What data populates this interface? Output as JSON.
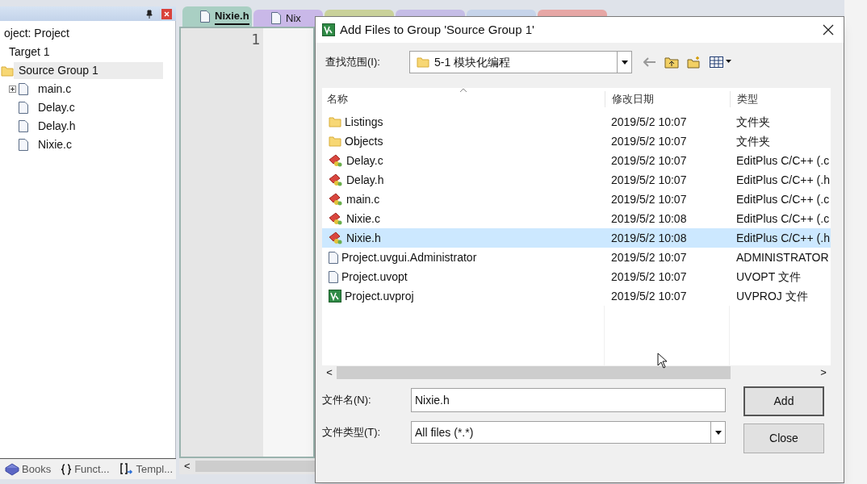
{
  "project_panel": {
    "tree": [
      {
        "label": "oject: Project",
        "selected": false,
        "children": [
          {
            "label": "Target 1",
            "selected": false,
            "children": [
              {
                "label": "Source Group 1",
                "selected": true,
                "kind": "folder",
                "children": [
                  {
                    "label": "main.c",
                    "kind": "file",
                    "expandable": true,
                    "selected": false
                  },
                  {
                    "label": "Delay.c",
                    "kind": "file",
                    "expandable": false,
                    "selected": false
                  },
                  {
                    "label": "Delay.h",
                    "kind": "file",
                    "expandable": false,
                    "selected": false
                  },
                  {
                    "label": "Nixie.c",
                    "kind": "file",
                    "expandable": false,
                    "selected": false
                  }
                ]
              }
            ]
          }
        ]
      }
    ],
    "bottom_tabs": [
      {
        "label": "Books",
        "kind": "books"
      },
      {
        "label": "Funct...",
        "kind": "functions"
      },
      {
        "label": "Templ...",
        "kind": "templates"
      }
    ]
  },
  "editor": {
    "tabs": [
      {
        "label": "Nixie.h",
        "selected": true,
        "color": "#a9cfc3"
      },
      {
        "label": "Nix",
        "selected": false,
        "color": "#c9b8e8"
      },
      {
        "selected": false,
        "color": "#c9d19a"
      },
      {
        "selected": false,
        "color": "#c5bde6"
      },
      {
        "selected": false,
        "color": "#c6d4ea"
      },
      {
        "selected": false,
        "color": "#e6a7a5"
      }
    ],
    "line_numbers": [
      "1"
    ],
    "scroll_left": "<"
  },
  "dialog": {
    "title": "Add Files to Group 'Source Group 1'",
    "look_in": {
      "label": "查找范围(I):",
      "value": "5-1 模块化编程"
    },
    "columns": [
      "名称",
      "修改日期",
      "类型"
    ],
    "files": [
      {
        "name": "Listings",
        "date": "2019/5/2 10:07",
        "type": "文件夹",
        "kind": "folder",
        "selected": false
      },
      {
        "name": "Objects",
        "date": "2019/5/2 10:07",
        "type": "文件夹",
        "kind": "folder",
        "selected": false
      },
      {
        "name": "Delay.c",
        "date": "2019/5/2 10:07",
        "type": "EditPlus C/C++ (.c",
        "kind": "source",
        "selected": false
      },
      {
        "name": "Delay.h",
        "date": "2019/5/2 10:07",
        "type": "EditPlus C/C++ (.h",
        "kind": "source",
        "selected": false
      },
      {
        "name": "main.c",
        "date": "2019/5/2 10:07",
        "type": "EditPlus C/C++ (.c",
        "kind": "source",
        "selected": false
      },
      {
        "name": "Nixie.c",
        "date": "2019/5/2 10:08",
        "type": "EditPlus C/C++ (.c",
        "kind": "source",
        "selected": false
      },
      {
        "name": "Nixie.h",
        "date": "2019/5/2 10:08",
        "type": "EditPlus C/C++ (.h",
        "kind": "source",
        "selected": true
      },
      {
        "name": "Project.uvgui.Administrator",
        "date": "2019/5/2 10:07",
        "type": "ADMINISTRATOR",
        "kind": "plain",
        "selected": false
      },
      {
        "name": "Project.uvopt",
        "date": "2019/5/2 10:07",
        "type": "UVOPT 文件",
        "kind": "plain",
        "selected": false
      },
      {
        "name": "Project.uvproj",
        "date": "2019/5/2 10:07",
        "type": "UVPROJ 文件",
        "kind": "project",
        "selected": false
      }
    ],
    "scroll_left": "<",
    "scroll_right": ">",
    "file_name": {
      "label": "文件名(N):",
      "value": "Nixie.h"
    },
    "file_type": {
      "label": "文件类型(T):",
      "value": "All files (*.*)"
    },
    "buttons": [
      "Add",
      "Close"
    ]
  }
}
